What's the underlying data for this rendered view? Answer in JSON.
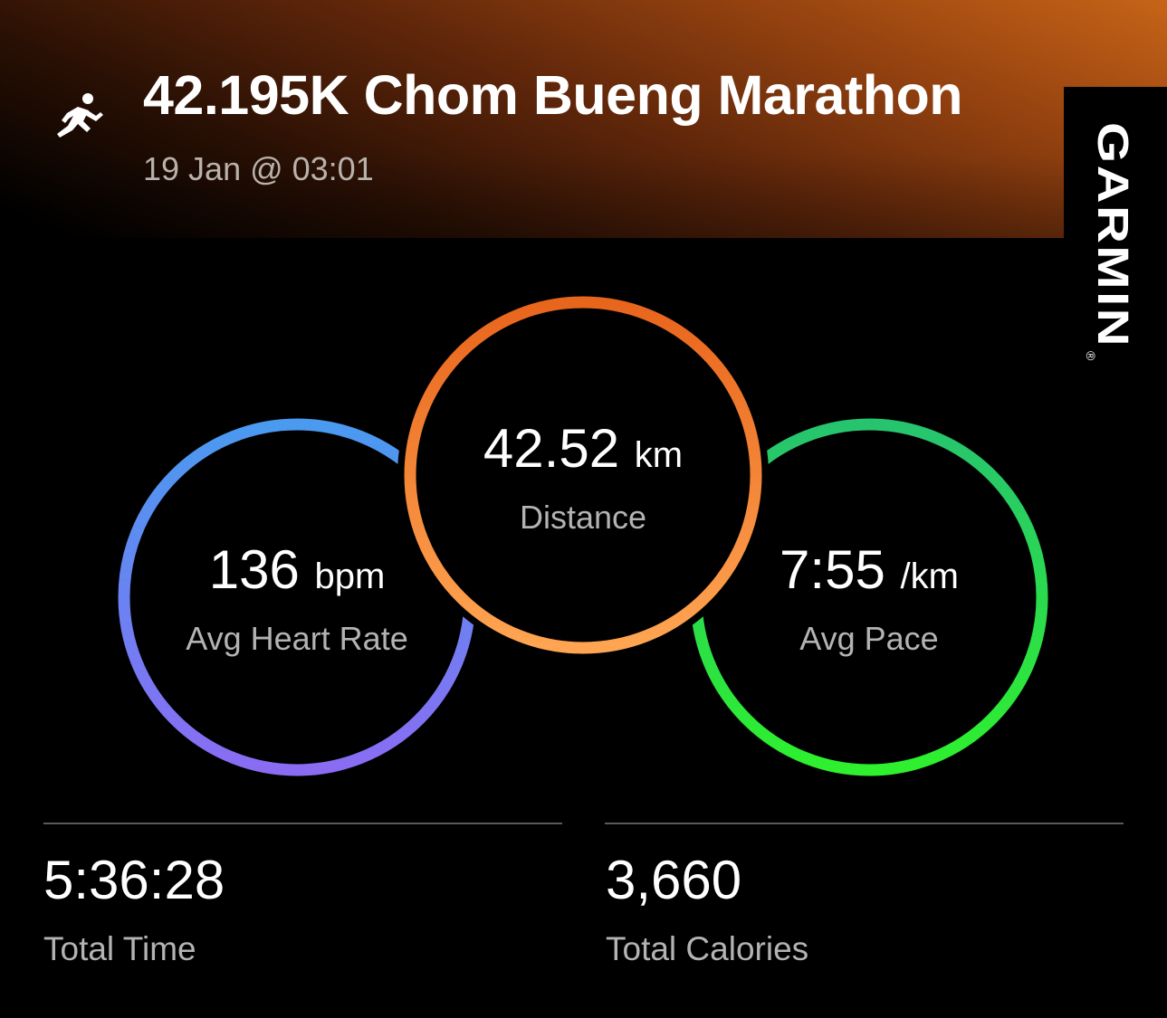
{
  "activity": {
    "type_icon": "running-person-icon",
    "title": "42.195K Chom Bueng Marathon",
    "date_time": "19 Jan @ 03:01"
  },
  "brand": {
    "name": "GARMIN",
    "mark": "®"
  },
  "metrics": {
    "distance": {
      "value": "42.52",
      "unit": "km",
      "label": "Distance",
      "color_start": "#e8651c",
      "color_end": "#ffa552"
    },
    "heart_rate": {
      "value": "136",
      "unit": "bpm",
      "label": "Avg Heart Rate",
      "color_start": "#4a9af0",
      "color_end": "#8a6cf3"
    },
    "pace": {
      "value": "7:55",
      "unit": "/km",
      "label": "Avg Pace",
      "color_start": "#27c46f",
      "color_end": "#2ef02e"
    }
  },
  "stats": {
    "total_time": {
      "value": "5:36:28",
      "label": "Total Time"
    },
    "total_calories": {
      "value": "3,660",
      "label": "Total Calories"
    }
  },
  "colors": {
    "header_accent": "#c66418",
    "background": "#000000",
    "label_gray": "#b3b3b3"
  }
}
